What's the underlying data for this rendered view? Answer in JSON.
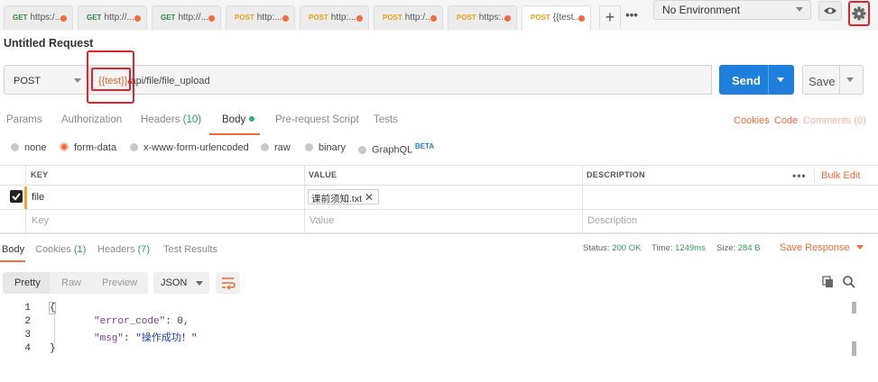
{
  "tabs": [
    {
      "method": "GET",
      "url": "https:/..."
    },
    {
      "method": "GET",
      "url": "http://..."
    },
    {
      "method": "GET",
      "url": "http://..."
    },
    {
      "method": "POST",
      "url": "http:..."
    },
    {
      "method": "POST",
      "url": "http:..."
    },
    {
      "method": "POST",
      "url": "http:/..."
    },
    {
      "method": "POST",
      "url": "https:..."
    },
    {
      "method": "POST",
      "url": "{{test..."
    }
  ],
  "environment": {
    "selected": "No Environment"
  },
  "request": {
    "title": "Untitled Request",
    "method": "POST",
    "url_var": "{{test}}",
    "url_path": "/api/file/file_upload",
    "send_label": "Send",
    "save_label": "Save"
  },
  "request_tabs": {
    "params": "Params",
    "authorization": "Authorization",
    "headers": "Headers",
    "headers_count": "(10)",
    "body": "Body",
    "pre_request": "Pre-request Script",
    "tests": "Tests",
    "cookies": "Cookies",
    "code": "Code",
    "comments": "Comments (0)"
  },
  "body_types": {
    "none": "none",
    "form_data": "form-data",
    "urlencoded": "x-www-form-urlencoded",
    "raw": "raw",
    "binary": "binary",
    "graphql": "GraphQL",
    "beta": "BETA"
  },
  "params_table": {
    "headers": {
      "key": "KEY",
      "value": "VALUE",
      "description": "DESCRIPTION"
    },
    "more": "•••",
    "bulk_edit": "Bulk Edit",
    "row": {
      "key": "file",
      "value": "课前须知.txt"
    },
    "placeholders": {
      "key": "Key",
      "value": "Value",
      "description": "Description"
    }
  },
  "response": {
    "tabs": {
      "body": "Body",
      "cookies": "Cookies",
      "cookies_count": "(1)",
      "headers": "Headers",
      "headers_count": "(7)",
      "test_results": "Test Results"
    },
    "status_label": "Status:",
    "status_value": "200 OK",
    "time_label": "Time:",
    "time_value": "1249ms",
    "size_label": "Size:",
    "size_value": "284 B",
    "save_response": "Save Response",
    "formats": {
      "pretty": "Pretty",
      "raw": "Raw",
      "preview": "Preview"
    },
    "language": "JSON",
    "code_lines": {
      "l1": "{",
      "l2_key": "\"error_code\"",
      "l2_val": "0",
      "l3_key": "\"msg\"",
      "l3_val": "\"操作成功！\"",
      "l4": "}"
    }
  },
  "colors": {
    "accent": "#f26b3a",
    "send": "#1f7fdc",
    "success": "#2e9e58",
    "highlight": "#e0242b"
  }
}
